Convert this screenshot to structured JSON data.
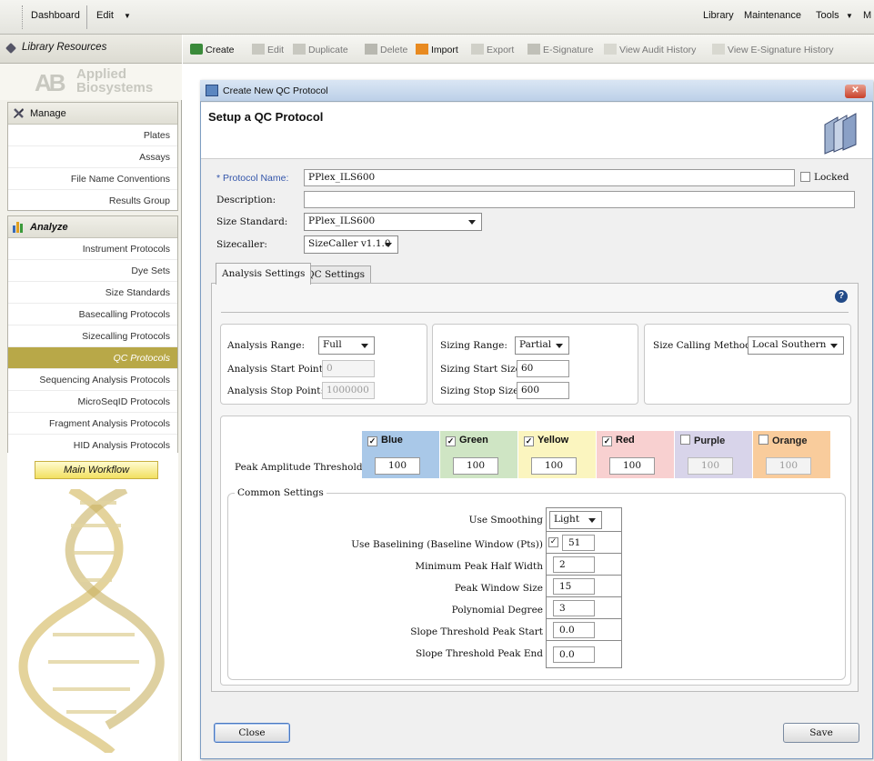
{
  "topmenu": {
    "dashboard": "Dashboard",
    "edit": "Edit",
    "library": "Library",
    "maintenance": "Maintenance",
    "tools": "Tools",
    "more": "M"
  },
  "sidebar": {
    "title": "Library Resources",
    "logo_line1": "Applied",
    "logo_line2": "Biosystems",
    "manage": {
      "label": "Manage",
      "items": [
        "Plates",
        "Assays",
        "File Name Conventions",
        "Results Group"
      ]
    },
    "analyze": {
      "label": "Analyze",
      "items": [
        "Instrument Protocols",
        "Dye Sets",
        "Size Standards",
        "Basecalling Protocols",
        "Sizecalling Protocols",
        "QC Protocols",
        "Sequencing Analysis Protocols",
        "MicroSeqID Protocols",
        "Fragment Analysis Protocols",
        "HID Analysis Protocols"
      ],
      "active": "QC Protocols"
    },
    "workflow": "Main Workflow"
  },
  "toolbar": {
    "create": "Create",
    "edit": "Edit",
    "duplicate": "Duplicate",
    "delete": "Delete",
    "import": "Import",
    "export": "Export",
    "esig": "E-Signature",
    "audit": "View Audit History",
    "esig_hist": "View E-Signature History"
  },
  "dialog": {
    "title": "Create New QC Protocol",
    "heading": "Setup a QC Protocol",
    "protocol_name_label": "Protocol Name:",
    "protocol_name_required": "*",
    "protocol_name": "PPlex_ILS600",
    "locked_label": "Locked",
    "description_label": "Description:",
    "description": "",
    "size_standard_label": "Size Standard:",
    "size_standard": "PPlex_ILS600",
    "sizecaller_label": "Sizecaller:",
    "sizecaller": "SizeCaller v1.1.0",
    "tabs": [
      "Analysis Settings",
      "QC Settings"
    ],
    "analysis": {
      "range_label": "Analysis Range:",
      "range": "Full",
      "start_label": "Analysis Start Point:",
      "start": "0",
      "stop_label": "Analysis Stop Point:",
      "stop": "1000000",
      "sizing_range_label": "Sizing Range:",
      "sizing_range": "Partial",
      "sizing_start_label": "Sizing Start Size:",
      "sizing_start": "60",
      "sizing_stop_label": "Sizing Stop Size:",
      "sizing_stop": "600",
      "method_label": "Size Calling Method:",
      "method": "Local Southern"
    },
    "peak_label": "Peak Amplitude Threshold",
    "channels": [
      {
        "name": "Blue",
        "checked": true,
        "value": "100",
        "color": "#a9c8e8",
        "enabled": true
      },
      {
        "name": "Green",
        "checked": true,
        "value": "100",
        "color": "#cfe5c4",
        "enabled": true
      },
      {
        "name": "Yellow",
        "checked": true,
        "value": "100",
        "color": "#fbf5bf",
        "enabled": true
      },
      {
        "name": "Red",
        "checked": true,
        "value": "100",
        "color": "#f8d0d0",
        "enabled": true
      },
      {
        "name": "Purple",
        "checked": false,
        "value": "100",
        "color": "#d8d4ea",
        "enabled": false
      },
      {
        "name": "Orange",
        "checked": false,
        "value": "100",
        "color": "#f9cc9c",
        "enabled": false
      }
    ],
    "common": {
      "title": "Common Settings",
      "smoothing_label": "Use Smoothing",
      "smoothing": "Light",
      "baselining_label": "Use Baselining (Baseline Window (Pts))",
      "baselining": "51",
      "half_width_label": "Minimum Peak Half Width",
      "half_width": "2",
      "window_label": "Peak Window Size",
      "window": "15",
      "poly_label": "Polynomial Degree",
      "poly": "3",
      "slope_start_label": "Slope Threshold Peak Start",
      "slope_start": "0.0",
      "slope_end_label": "Slope Threshold Peak End",
      "slope_end": "0.0"
    },
    "close": "Close",
    "save": "Save"
  }
}
